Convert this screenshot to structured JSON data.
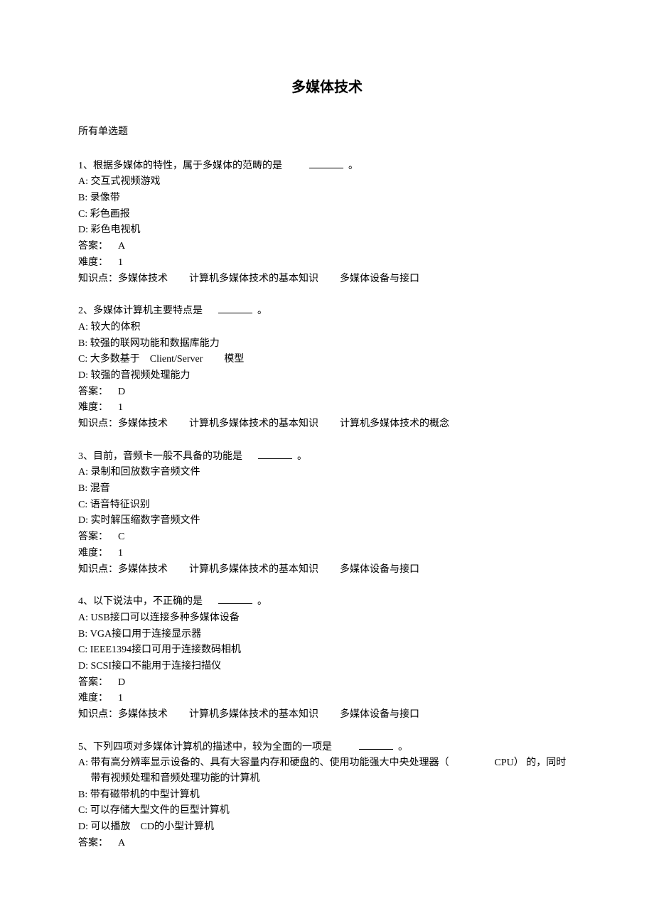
{
  "title": "多媒体技术",
  "section_label": "所有单选题",
  "questions": [
    {
      "stem_pre": "1、根据多媒体的特性，属于多媒体的范畴的是",
      "stem_post": "。",
      "options": {
        "A": "交互式视频游戏",
        "B": "录像带",
        "C": "彩色画报",
        "D": "彩色电视机"
      },
      "answer_label": "答案：",
      "answer": "A",
      "difficulty_label": "难度：",
      "difficulty": "1",
      "knowledge_label": "知识点：",
      "knowledge_parts": [
        "多媒体技术",
        "计算机多媒体技术的基本知识",
        "多媒体设备与接口"
      ]
    },
    {
      "stem_pre": "2、多媒体计算机主要特点是",
      "stem_post": "。",
      "options": {
        "A": "较大的体积",
        "B": "较强的联网功能和数据库能力",
        "C_pre": "大多数基于",
        "C_mid": "Client/Server",
        "C_post": "模型",
        "D": "较强的音视频处理能力"
      },
      "answer_label": "答案：",
      "answer": "D",
      "difficulty_label": "难度：",
      "difficulty": "1",
      "knowledge_label": "知识点：",
      "knowledge_parts": [
        "多媒体技术",
        "计算机多媒体技术的基本知识",
        "计算机多媒体技术的概念"
      ]
    },
    {
      "stem_pre": "3、目前，音频卡一般不具备的功能是",
      "stem_post": "。",
      "options": {
        "A": "录制和回放数字音频文件",
        "B": "混音",
        "C": "语音特征识别",
        "D": "实时解压缩数字音频文件"
      },
      "answer_label": "答案：",
      "answer": "C",
      "difficulty_label": "难度：",
      "difficulty": "1",
      "knowledge_label": "知识点：",
      "knowledge_parts": [
        "多媒体技术",
        "计算机多媒体技术的基本知识",
        "多媒体设备与接口"
      ]
    },
    {
      "stem_pre": "4、以下说法中，不正确的是",
      "stem_post": "。",
      "options": {
        "A_label": "USB",
        "A_text": "接口可以连接多种多媒体设备",
        "B_label": "VGA",
        "B_text": "接口用于连接显示器",
        "C_label": "IEEE1394",
        "C_text": "接口可用于连接数码相机",
        "D_label": "SCSI",
        "D_text": "接口不能用于连接扫描仪"
      },
      "answer_label": "答案：",
      "answer": "D",
      "difficulty_label": "难度：",
      "difficulty": "1",
      "knowledge_label": "知识点：",
      "knowledge_parts": [
        "多媒体技术",
        "计算机多媒体技术的基本知识",
        "多媒体设备与接口"
      ]
    },
    {
      "stem_pre": "5、下列四项对多媒体计算机的描述中，较为全面的一项是",
      "stem_post": "。",
      "options": {
        "A_pre": "带有高分辨率显示设备的、具有大容量内存和硬盘的、使用功能强大中央处理器（",
        "A_mid": "CPU）",
        "A_post": "的，同时带有视频处理和音频处理功能的计算机",
        "B": "带有磁带机的中型计算机",
        "C": "可以存储大型文件的巨型计算机",
        "D_pre": "可以播放",
        "D_mid": "CD",
        "D_post": "的小型计算机"
      },
      "answer_label": "答案：",
      "answer": "A"
    }
  ]
}
